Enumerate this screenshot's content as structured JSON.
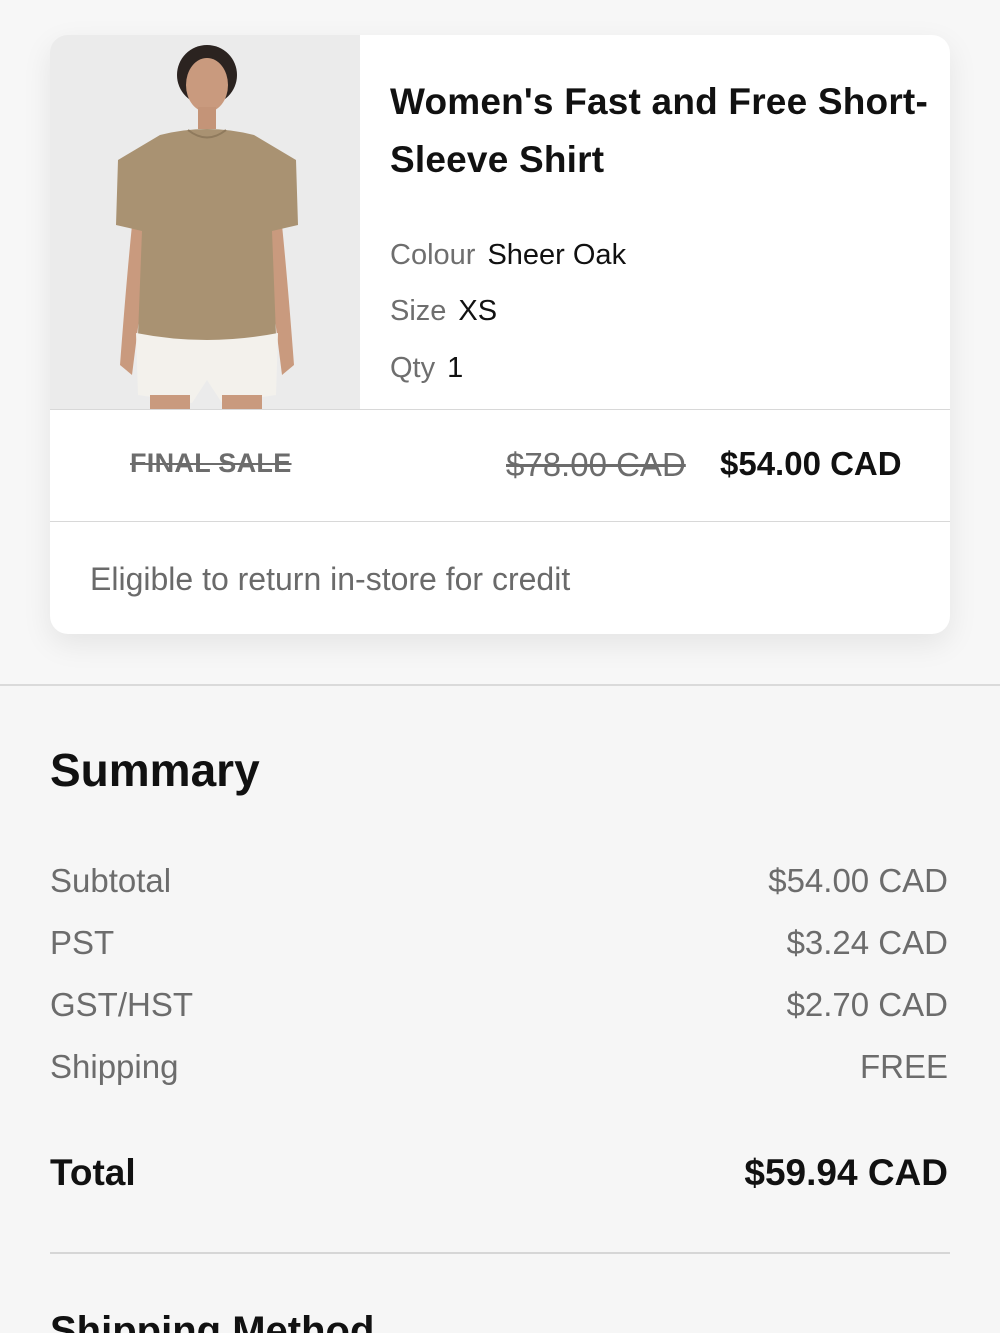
{
  "product": {
    "title": "Women's Fast and Free Short-Sleeve Shirt",
    "image_icon": "product-photo-model-wearing-shirt",
    "colour_label": "Colour",
    "colour_value": "Sheer Oak",
    "size_label": "Size",
    "size_value": "XS",
    "qty_label": "Qty",
    "qty_value": "1",
    "final_sale": "FINAL SALE",
    "original_price": "$78.00 CAD",
    "sale_price": "$54.00 CAD",
    "return_note": "Eligible to return in-store for credit"
  },
  "summary": {
    "heading": "Summary",
    "rows": [
      {
        "label": "Subtotal",
        "value": "$54.00 CAD"
      },
      {
        "label": "PST",
        "value": "$3.24 CAD"
      },
      {
        "label": "GST/HST",
        "value": "$2.70 CAD"
      },
      {
        "label": "Shipping",
        "value": "FREE"
      }
    ],
    "total_label": "Total",
    "total_value": "$59.94 CAD"
  },
  "next_section": {
    "heading": "Shipping Method"
  },
  "colors": {
    "shirt": "#a99272",
    "shorts": "#f3f1ec",
    "image_bg": "#ebebeb"
  }
}
